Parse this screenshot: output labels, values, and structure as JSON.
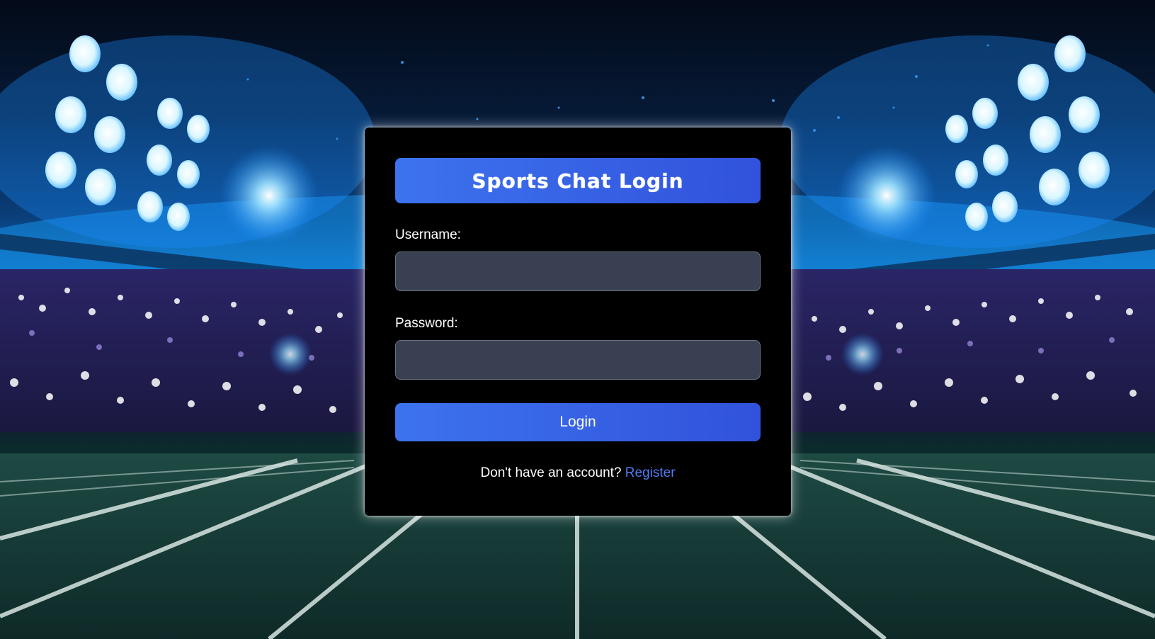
{
  "login": {
    "title": "Sports Chat Login",
    "username_label": "Username:",
    "username_value": "",
    "password_label": "Password:",
    "password_value": "",
    "login_button": "Login",
    "register_prompt": "Don't have an account?",
    "register_link": "Register"
  },
  "colors": {
    "accent": "#3d73ee",
    "accent_dark": "#3152dc",
    "card": "#000000",
    "input_bg": "#394051",
    "link": "#4f7cf5"
  },
  "background": {
    "scene": "stadium-floodlights-background"
  }
}
